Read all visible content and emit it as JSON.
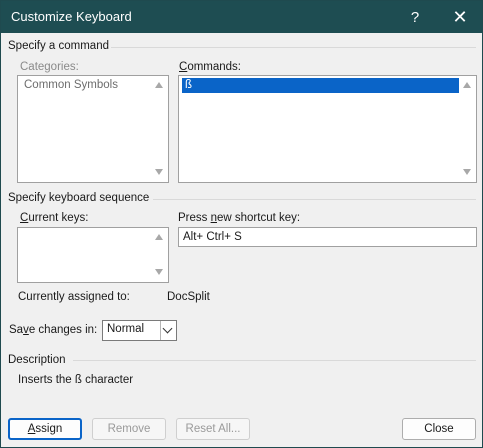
{
  "window": {
    "title": "Customize Keyboard",
    "help_glyph": "?",
    "close_glyph": "✕"
  },
  "specify_command": {
    "heading": "Specify a command",
    "categories_label": "Categories:",
    "categories": [
      "Common Symbols"
    ],
    "commands_label_accel": "C",
    "commands_label_rest": "ommands:",
    "commands": [
      "ß"
    ],
    "selected_command": "ß"
  },
  "keyboard_sequence": {
    "heading": "Specify keyboard sequence",
    "current_keys_label_accel": "C",
    "current_keys_label_rest": "urrent keys:",
    "current_keys": [],
    "new_key_label_pre": "Press ",
    "new_key_label_accel": "n",
    "new_key_label_rest": "ew shortcut key:",
    "new_key_value": "Alt+ Ctrl+ S",
    "assigned_label": "Currently assigned to:",
    "assigned_value": "DocSplit"
  },
  "save_changes": {
    "label_pre": "Sa",
    "label_accel": "v",
    "label_rest": "e changes in:",
    "selected": "Normal"
  },
  "description": {
    "heading": "Description",
    "text": "Inserts the ß character"
  },
  "buttons": {
    "assign_accel": "A",
    "assign_rest": "ssign",
    "remove": "Remove",
    "reset_all": "Reset All...",
    "close": "Close"
  }
}
